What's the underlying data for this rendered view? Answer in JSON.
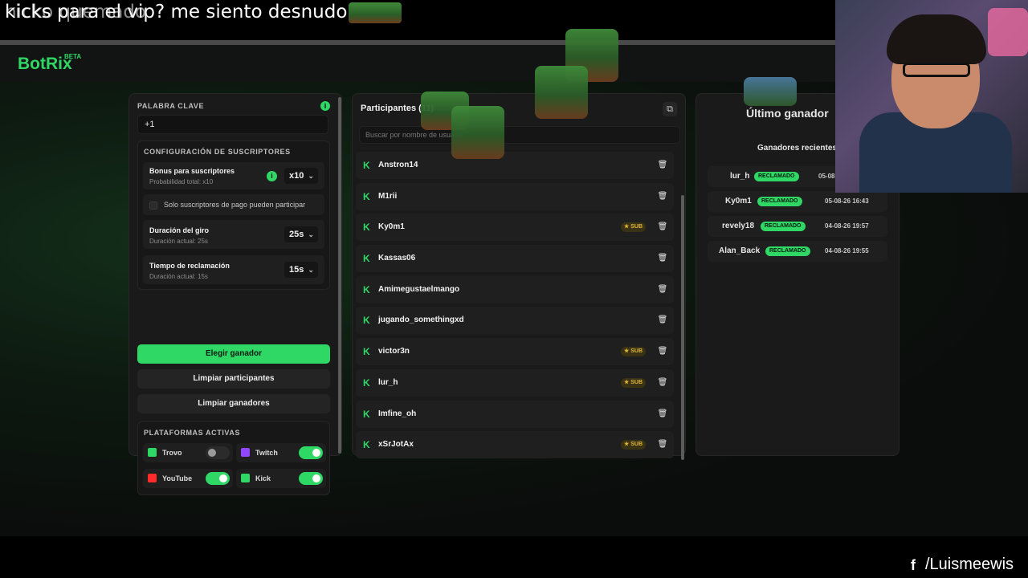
{
  "chat_overlay": {
    "line_1": "kicks para el vip? me siento desnudo",
    "line_2": "nicko quemado"
  },
  "header": {
    "logo": "BotRix",
    "beta": "BETA"
  },
  "keyword": {
    "label": "PALABRA CLAVE",
    "value": "+1"
  },
  "subscriber_config": {
    "title": "CONFIGURACIÓN DE SUSCRIPTORES",
    "bonus": {
      "title": "Bonus para suscriptores",
      "subtitle": "Probabilidad total: x10",
      "value": "x10"
    },
    "paid_only": "Solo suscriptores de pago pueden participar",
    "spin_duration": {
      "title": "Duración del giro",
      "subtitle": "Duración actual: 25s",
      "value": "25s"
    },
    "claim_time": {
      "title": "Tiempo de reclamación",
      "subtitle": "Duración actual: 15s",
      "value": "15s"
    }
  },
  "buttons": {
    "pick_winner": "Elegir ganador",
    "clear_participants": "Limpiar participantes",
    "clear_winners": "Limpiar ganadores"
  },
  "platforms": {
    "title": "PLATAFORMAS ACTIVAS",
    "items": [
      {
        "name": "Trovo",
        "enabled": false
      },
      {
        "name": "Twitch",
        "enabled": true
      },
      {
        "name": "YouTube",
        "enabled": true
      },
      {
        "name": "Kick",
        "enabled": true
      }
    ]
  },
  "participants": {
    "title": "Participantes (11)",
    "search_placeholder": "Buscar por nombre de usuario",
    "sub_label": "SUB",
    "list": [
      {
        "name": "Anstron14",
        "sub": false
      },
      {
        "name": "M1rii",
        "sub": false
      },
      {
        "name": "Ky0m1",
        "sub": true
      },
      {
        "name": "Kassas06",
        "sub": false
      },
      {
        "name": "Amimegustaelmango",
        "sub": false
      },
      {
        "name": "jugando_somethingxd",
        "sub": false
      },
      {
        "name": "victor3n",
        "sub": true
      },
      {
        "name": "lur_h",
        "sub": true
      },
      {
        "name": "Imfine_oh",
        "sub": false
      },
      {
        "name": "xSrJotAx",
        "sub": true
      }
    ]
  },
  "winners": {
    "last_winner_label": "Último ganador",
    "recent_label": "Ganadores recientes",
    "claimed_label": "RECLAMADO",
    "list": [
      {
        "name": "lur_h",
        "date": "05-08"
      },
      {
        "name": "Ky0m1",
        "date": "05-08-26 16:43"
      },
      {
        "name": "revely18",
        "date": "04-08-26 19:57"
      },
      {
        "name": "Alan_Back",
        "date": "04-08-26 19:55"
      }
    ]
  },
  "footer": {
    "facebook_handle": "/Luismeewis"
  },
  "colors": {
    "accent": "#2fd865",
    "panel": "#191a19",
    "background": "#0b0d0c"
  }
}
